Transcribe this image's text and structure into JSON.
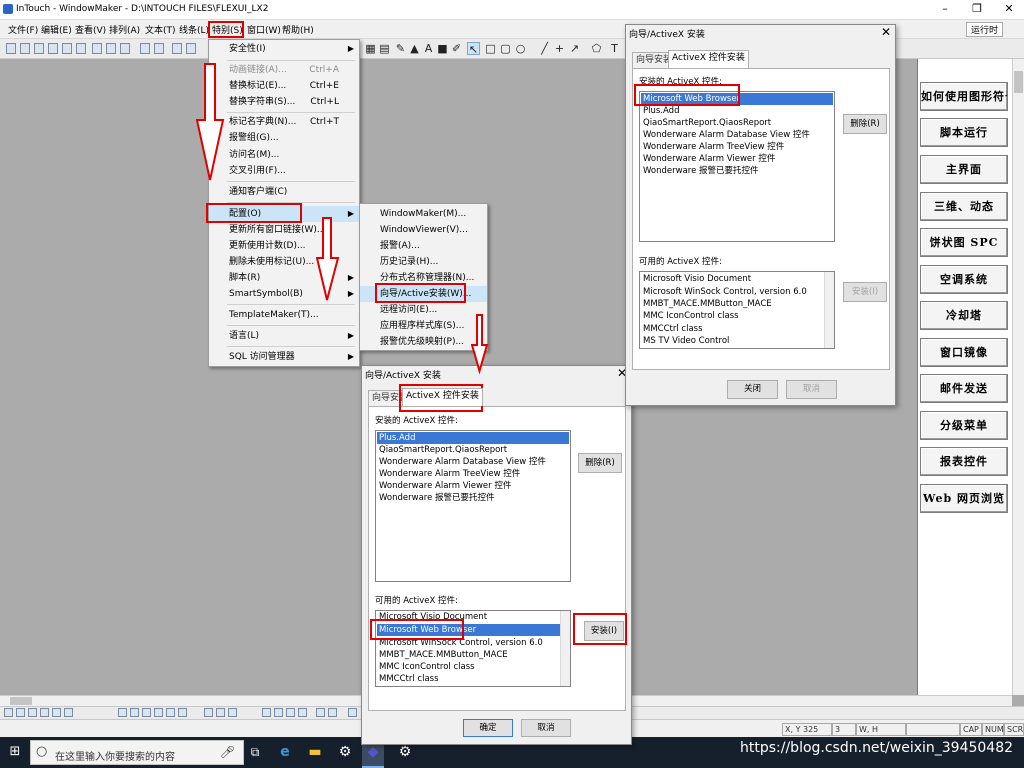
{
  "window": {
    "title": "InTouch - WindowMaker - D:\\INTOUCH FILES\\FLEXUI_LX2",
    "min_glyph": "–",
    "restore_glyph": "❐",
    "close_glyph": "✕",
    "run_label": "运行时"
  },
  "menubar": {
    "items": [
      "文件(F)",
      "编辑(E)",
      "查看(V)",
      "排列(A)",
      "文本(T)",
      "线条(L)",
      "特别(S)",
      "窗口(W)",
      "帮助(H)"
    ]
  },
  "special_menu": {
    "items": [
      {
        "label": "安全性(I)",
        "shortcut": "",
        "submenu": true,
        "disabled": false
      },
      {
        "label": "动画链接(A)...",
        "shortcut": "Ctrl+A",
        "submenu": false,
        "disabled": true
      },
      {
        "label": "替换标记(E)...",
        "shortcut": "Ctrl+E",
        "submenu": false,
        "disabled": false
      },
      {
        "label": "替换字符串(S)...",
        "shortcut": "Ctrl+L",
        "submenu": false,
        "disabled": false
      },
      {
        "label": "标记名字典(N)...",
        "shortcut": "Ctrl+T",
        "submenu": false,
        "disabled": false
      },
      {
        "label": "报警组(G)...",
        "shortcut": "",
        "submenu": false,
        "disabled": false
      },
      {
        "label": "访问名(M)...",
        "shortcut": "",
        "submenu": false,
        "disabled": false
      },
      {
        "label": "交叉引用(F)...",
        "shortcut": "",
        "submenu": false,
        "disabled": false
      },
      {
        "label": "通知客户端(C)",
        "shortcut": "",
        "submenu": false,
        "disabled": false
      },
      {
        "label": "配置(O)",
        "shortcut": "",
        "submenu": true,
        "disabled": false
      },
      {
        "label": "更新所有窗口链接(W)...",
        "shortcut": "",
        "submenu": false,
        "disabled": false
      },
      {
        "label": "更新使用计数(D)...",
        "shortcut": "",
        "submenu": false,
        "disabled": false
      },
      {
        "label": "删除未使用标记(U)...",
        "shortcut": "",
        "submenu": false,
        "disabled": false
      },
      {
        "label": "脚本(R)",
        "shortcut": "",
        "submenu": true,
        "disabled": false
      },
      {
        "label": "SmartSymbol(B)",
        "shortcut": "",
        "submenu": true,
        "disabled": false
      },
      {
        "label": "TemplateMaker(T)...",
        "shortcut": "",
        "submenu": false,
        "disabled": false
      },
      {
        "label": "语言(L)",
        "shortcut": "",
        "submenu": true,
        "disabled": false
      },
      {
        "label": "SQL 访问管理器",
        "shortcut": "",
        "submenu": true,
        "disabled": false
      }
    ]
  },
  "config_submenu": {
    "items": [
      "WindowMaker(M)...",
      "WindowViewer(V)...",
      "报警(A)...",
      "历史记录(H)...",
      "分布式名称管理器(N)...",
      "向导/Active安装(W)...",
      "远程访问(E)...",
      "应用程序样式库(S)...",
      "报警优先级映射(P)..."
    ]
  },
  "dialog": {
    "title": "向导/ActiveX 安装",
    "close_glyph": "✕",
    "tab_wizard": "向导安装",
    "tab_activex": "ActiveX 控件安装",
    "installed_label": "安装的 ActiveX 控件:",
    "available_label": "可用的 ActiveX 控件:",
    "remove_btn": "删除(R)",
    "install_btn": "安装(I)",
    "ok_btn": "确定",
    "cancel_btn": "取消",
    "close_btn": "关闭"
  },
  "dialog_before": {
    "installed": [
      "Plus.Add",
      "QiaoSmartReport.QiaosReport",
      "Wonderware Alarm Database View 控件",
      "Wonderware Alarm TreeView 控件",
      "Wonderware Alarm Viewer 控件",
      "Wonderware 报警已要托控件"
    ],
    "available": [
      "Microsoft Visio Document",
      "Microsoft Web Browser",
      "Microsoft WinSock Control, version 6.0",
      "MMBT_MACE.MMButton_MACE",
      "MMC IconControl class",
      "MMCCtrl class"
    ]
  },
  "dialog_after": {
    "installed": [
      "Microsoft Web Browser",
      "Plus.Add",
      "QiaoSmartReport.QiaosReport",
      "Wonderware Alarm Database View 控件",
      "Wonderware Alarm TreeView 控件",
      "Wonderware Alarm Viewer 控件",
      "Wonderware 报警已要托控件"
    ],
    "available": [
      "Microsoft Visio Document",
      "Microsoft WinSock Control, version 6.0",
      "MMBT_MACE.MMButton_MACE",
      "MMC IconControl class",
      "MMCCtrl class",
      "MS TV Video Control"
    ]
  },
  "right_panel": {
    "buttons": [
      "如何使用图形符号",
      "脚本运行",
      "主界面",
      "三维、动态",
      "饼状图 SPC",
      "空调系统",
      "冷却塔",
      "窗口镜像",
      "邮件发送",
      "分级菜单",
      "报表控件",
      "Web 网页浏览"
    ]
  },
  "statusbar": {
    "coords_label": "X, Y",
    "x": "325",
    "y": "3",
    "size_label": "W, H",
    "caps": "CAP",
    "num": "NUM",
    "scrl": "SCRL"
  },
  "taskbar": {
    "search_placeholder": "在这里输入你要搜索的内容"
  },
  "watermark": "https://blog.csdn.net/weixin_39450482"
}
